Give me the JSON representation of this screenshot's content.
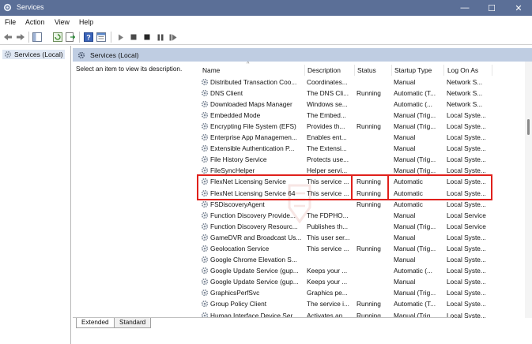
{
  "window": {
    "title": "Services",
    "icon": "gear-icon",
    "controls": [
      "minimize-icon",
      "maximize-icon",
      "close-icon"
    ]
  },
  "menu": [
    "File",
    "Action",
    "View",
    "Help"
  ],
  "toolbar_icons": [
    "back-arrow-icon",
    "forward-arrow-icon",
    "console-tree-icon",
    "refresh-icon",
    "export-icon",
    "help-icon",
    "properties-icon",
    "play-icon",
    "stop-icon",
    "pause-icon",
    "restart-icon"
  ],
  "left_pane": {
    "node_label": "Services (Local)"
  },
  "right_pane": {
    "header": "Services (Local)",
    "description": "Select an item to view its description."
  },
  "columns": {
    "name": "Name",
    "description": "Description",
    "status": "Status",
    "startup": "Startup Type",
    "logon": "Log On As"
  },
  "services": [
    {
      "name": "Distributed Transaction Coo...",
      "description": "Coordinates...",
      "status": "",
      "startup": "Manual",
      "logon": "Network S..."
    },
    {
      "name": "DNS Client",
      "description": "The DNS Cli...",
      "status": "Running",
      "startup": "Automatic (T...",
      "logon": "Network S..."
    },
    {
      "name": "Downloaded Maps Manager",
      "description": "Windows se...",
      "status": "",
      "startup": "Automatic (...",
      "logon": "Network S..."
    },
    {
      "name": "Embedded Mode",
      "description": "The Embed...",
      "status": "",
      "startup": "Manual (Trig...",
      "logon": "Local Syste..."
    },
    {
      "name": "Encrypting File System (EFS)",
      "description": "Provides th...",
      "status": "Running",
      "startup": "Manual (Trig...",
      "logon": "Local Syste..."
    },
    {
      "name": "Enterprise App Managemen...",
      "description": "Enables ent...",
      "status": "",
      "startup": "Manual",
      "logon": "Local Syste..."
    },
    {
      "name": "Extensible Authentication P...",
      "description": "The Extensi...",
      "status": "",
      "startup": "Manual",
      "logon": "Local Syste..."
    },
    {
      "name": "File History Service",
      "description": "Protects use...",
      "status": "",
      "startup": "Manual (Trig...",
      "logon": "Local Syste..."
    },
    {
      "name": "FileSyncHelper",
      "description": "Helper servi...",
      "status": "",
      "startup": "Manual (Trig...",
      "logon": "Local Syste..."
    },
    {
      "name": "FlexNet Licensing Service",
      "description": "This service ...",
      "status": "Running",
      "startup": "Automatic",
      "logon": "Local Syste..."
    },
    {
      "name": "FlexNet Licensing Service 64",
      "description": "This service ...",
      "status": "Running",
      "startup": "Automatic",
      "logon": "Local Syste..."
    },
    {
      "name": "FSDiscoveryAgent",
      "description": "",
      "status": "Running",
      "startup": "Automatic",
      "logon": "Local Syste..."
    },
    {
      "name": "Function Discovery Provide...",
      "description": "The FDPHO...",
      "status": "",
      "startup": "Manual",
      "logon": "Local Service"
    },
    {
      "name": "Function Discovery Resourc...",
      "description": "Publishes th...",
      "status": "",
      "startup": "Manual (Trig...",
      "logon": "Local Service"
    },
    {
      "name": "GameDVR and Broadcast Us...",
      "description": "This user ser...",
      "status": "",
      "startup": "Manual",
      "logon": "Local Syste..."
    },
    {
      "name": "Geolocation Service",
      "description": "This service ...",
      "status": "Running",
      "startup": "Manual (Trig...",
      "logon": "Local Syste..."
    },
    {
      "name": "Google Chrome Elevation S...",
      "description": "",
      "status": "",
      "startup": "Manual",
      "logon": "Local Syste..."
    },
    {
      "name": "Google Update Service (gup...",
      "description": "Keeps your ...",
      "status": "",
      "startup": "Automatic (...",
      "logon": "Local Syste..."
    },
    {
      "name": "Google Update Service (gup...",
      "description": "Keeps your ...",
      "status": "",
      "startup": "Manual",
      "logon": "Local Syste..."
    },
    {
      "name": "GraphicsPerfSvc",
      "description": "Graphics pe...",
      "status": "",
      "startup": "Manual (Trig...",
      "logon": "Local Syste..."
    },
    {
      "name": "Group Policy Client",
      "description": "The service i...",
      "status": "Running",
      "startup": "Automatic (T...",
      "logon": "Local Syste..."
    },
    {
      "name": "Human Interface Device Ser...",
      "description": "Activates an...",
      "status": "Running",
      "startup": "Manual (Trig...",
      "logon": "Local Syste..."
    }
  ],
  "tabs": {
    "extended": "Extended",
    "standard": "Standard"
  },
  "highlight_color": "#e0201b"
}
